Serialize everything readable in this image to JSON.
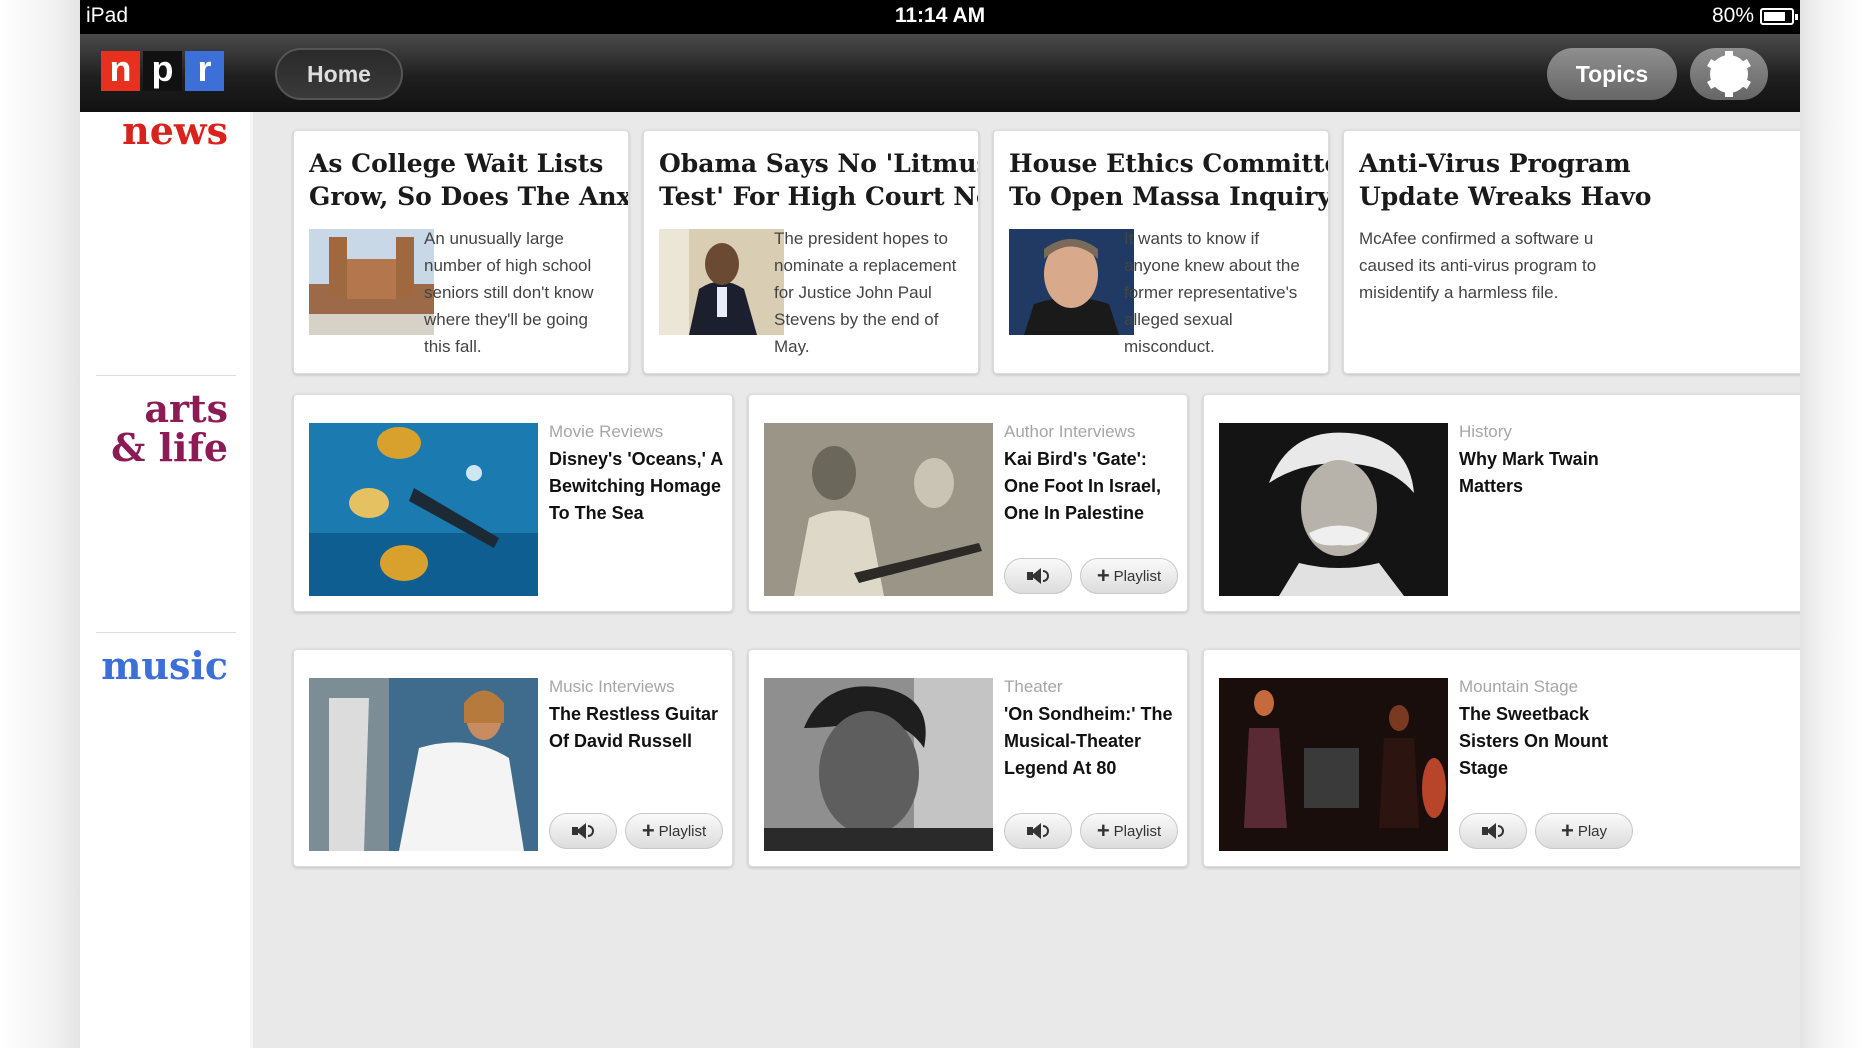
{
  "status_bar": {
    "carrier": "iPad",
    "time": "11:14 AM",
    "battery": "80%",
    "battery_level": 0.8
  },
  "nav": {
    "logo": [
      "n",
      "p",
      "r"
    ],
    "home_label": "Home",
    "topics_label": "Topics",
    "settings_icon": "gear-icon"
  },
  "sections": {
    "news": "news",
    "arts_line1": "arts",
    "arts_line2": "& life",
    "music": "music"
  },
  "colors": {
    "news": "#d9221c",
    "arts": "#8b1a55",
    "music": "#3d6fd8",
    "navbar": "#1f1f1f"
  },
  "news": [
    {
      "title_l1": "As College Wait Lists",
      "title_l2": "Grow, So Does The Anxiety",
      "text": [
        "An unusually large",
        "number of high school",
        "seniors still don't know",
        "where they'll be going",
        "this fall."
      ]
    },
    {
      "title_l1": "Obama Says No 'Litmus",
      "title_l2": "Test' For High Court No...",
      "text": [
        "The president hopes to",
        "nominate a replacement",
        "for Justice John Paul",
        "Stevens by the end of",
        "May."
      ]
    },
    {
      "title_l1": "House Ethics Committee",
      "title_l2": "To Open Massa Inquiry",
      "text": [
        "It wants to know if",
        "anyone knew about the",
        "former representative's",
        "alleged sexual",
        "misconduct."
      ]
    },
    {
      "title_l1": "Anti-Virus Program",
      "title_l2": "Update Wreaks Havo",
      "text": [
        "McAfee confirmed a software u",
        "caused its anti-virus program to",
        "misidentify a harmless file."
      ]
    }
  ],
  "arts": [
    {
      "category": "Movie Reviews",
      "title": "Disney's 'Oceans,' A Bewitching Homage To The Sea"
    },
    {
      "category": "Author Interviews",
      "title": "Kai Bird's 'Gate': One Foot In Israel, One In Palestine"
    },
    {
      "category": "History",
      "title": "Why Mark Twain Matters"
    }
  ],
  "music": [
    {
      "category": "Music Interviews",
      "title": "The Restless Guitar Of David Russell"
    },
    {
      "category": "Theater",
      "title": "'On Sondheim:' The Musical-Theater Legend At 80"
    },
    {
      "category": "Mountain Stage",
      "title": "The Sweetback Sisters On Mount Stage"
    }
  ],
  "buttons": {
    "playlist": "Playlist",
    "playlist_cut": "Play",
    "plus": "+"
  }
}
